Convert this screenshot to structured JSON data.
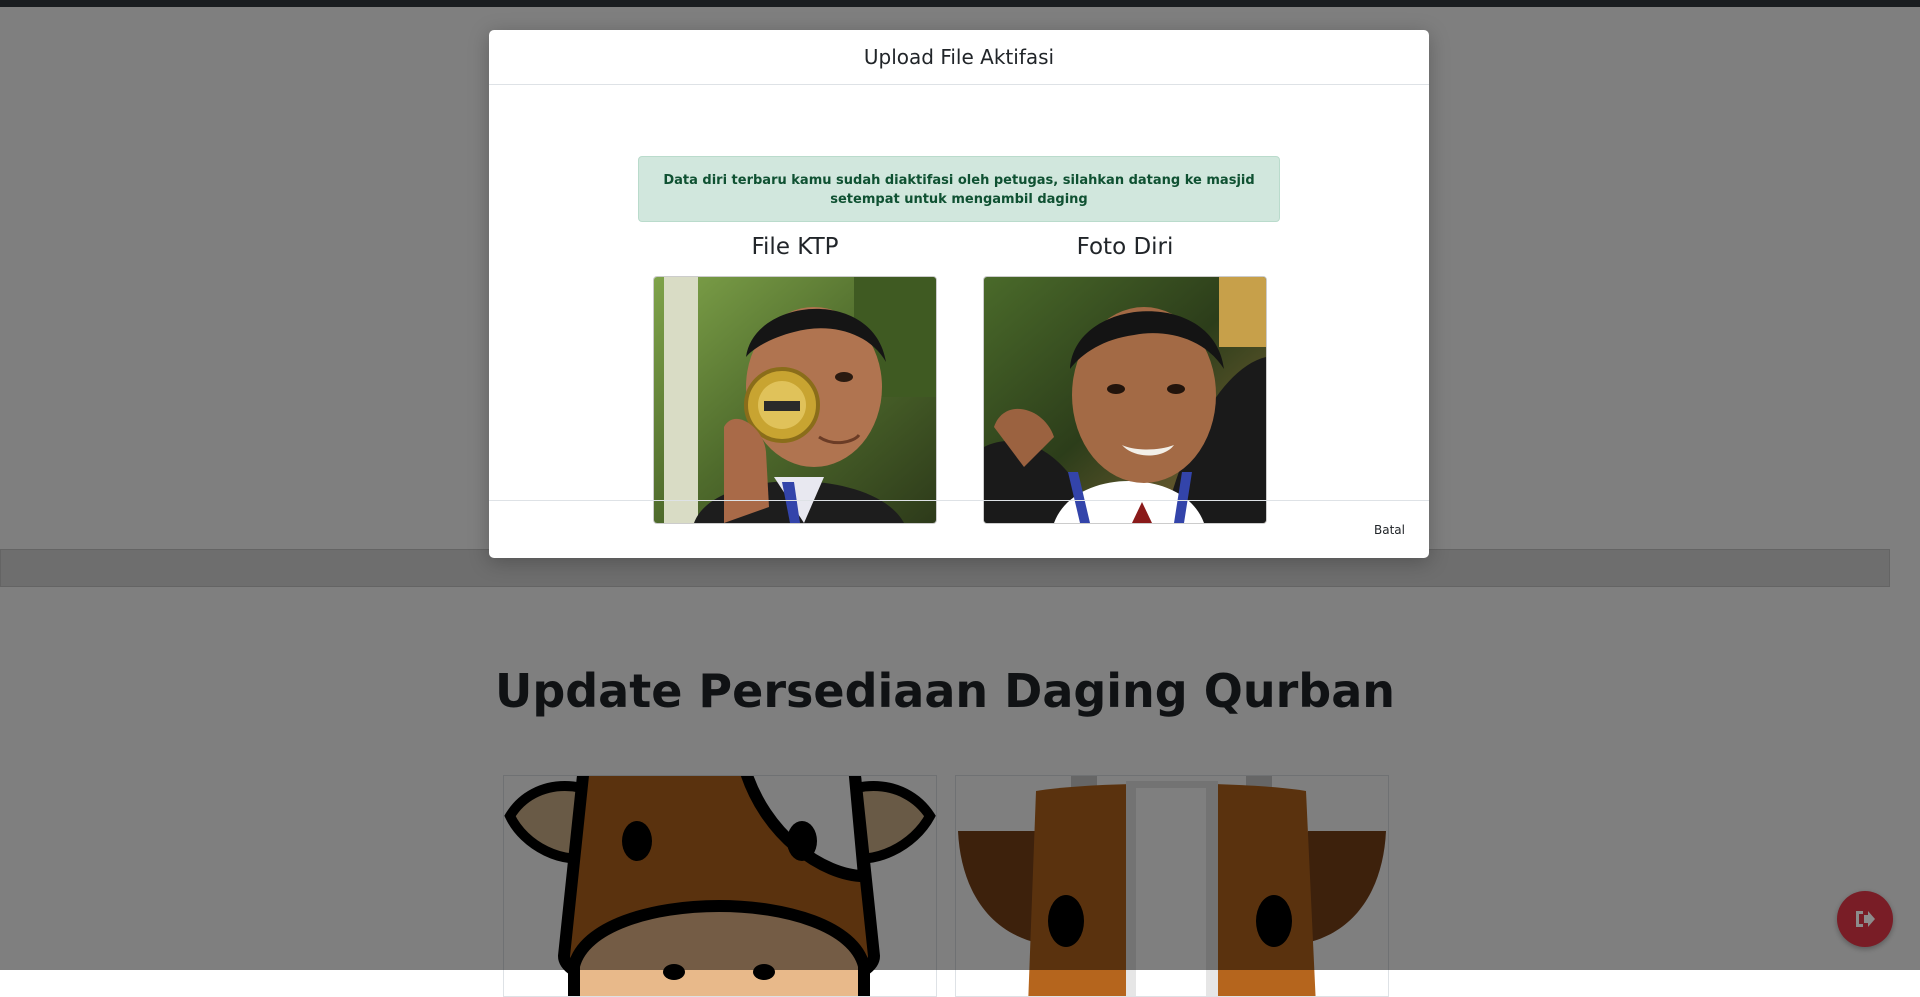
{
  "page": {
    "heading": "Update Persediaan Daging Qurban"
  },
  "modal": {
    "title": "Upload File Aktifasi",
    "alert": "Data diri terbaru kamu sudah diaktifasi oleh petugas, silahkan datang ke masjid setempat untuk mengambil daging",
    "columns": [
      {
        "title": "File KTP"
      },
      {
        "title": "Foto Diri"
      }
    ],
    "footer": {
      "cancel_label": "Batal"
    }
  },
  "colors": {
    "alert_bg": "#d1e7dd",
    "alert_text": "#0f5132",
    "fab": "#dc3545",
    "cow_brown": "#b5651d",
    "backdrop": "rgba(0,0,0,0.5)"
  },
  "icons": {
    "fab": "sign-out-icon"
  }
}
